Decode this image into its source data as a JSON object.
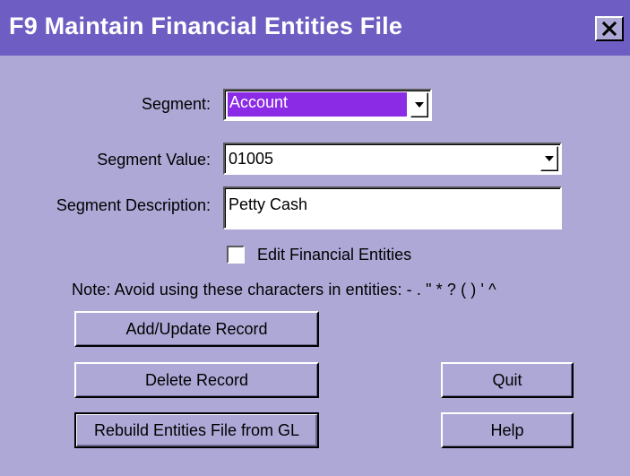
{
  "window": {
    "title": "F9 Maintain Financial Entities File",
    "close_glyph": "✕",
    "colors": {
      "title_bar": "#6E5EC3",
      "dialog": "#ADA8D6",
      "selection": "#8B2BE6"
    }
  },
  "form": {
    "segment_label": "Segment:",
    "segment_value": "Account",
    "segment_value_label": "Segment Value:",
    "segment_value_value": "01005",
    "segment_description_label": "Segment Description:",
    "segment_description_value": "Petty Cash",
    "edit_entities_label": "Edit Financial Entities",
    "edit_entities_checked": false,
    "note": "Note: Avoid using these characters in entities: - .  \" * ? ( ) ' ^"
  },
  "buttons": {
    "add_update": "Add/Update  Record",
    "delete": "Delete Record",
    "rebuild": "Rebuild Entities File from GL",
    "quit": "Quit",
    "help": "Help"
  }
}
